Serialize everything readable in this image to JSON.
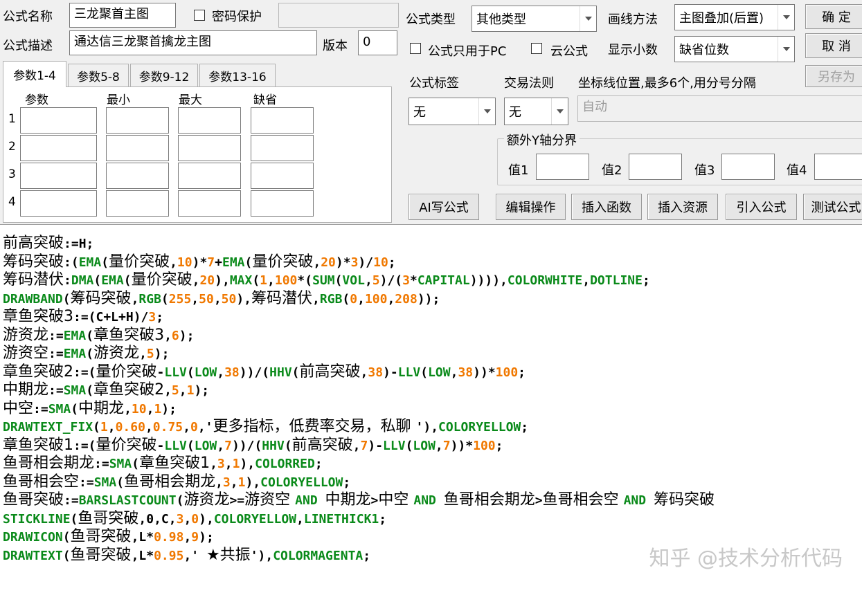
{
  "header": {
    "name_label": "公式名称",
    "name_value": "三龙聚首主图",
    "password_label": "密码保护",
    "password_value": "",
    "desc_label": "公式描述",
    "desc_value": "通达信三龙聚首擒龙主图",
    "version_label": "版本",
    "version_value": "0",
    "type_label": "公式类型",
    "type_value": "其他类型",
    "draw_label": "画线方法",
    "draw_value": "主图叠加(后置)",
    "pc_only_label": "公式只用于PC",
    "cloud_label": "云公式",
    "decimals_label": "显示小数",
    "decimals_value": "缺省位数"
  },
  "buttons": {
    "ok": "确 定",
    "cancel": "取 消",
    "save_as": "另存为",
    "ai": "AI写公式",
    "edit": "编辑操作",
    "insert_func": "插入函数",
    "insert_res": "插入资源",
    "import": "引入公式",
    "test": "测试公式"
  },
  "tabs": [
    "参数1-4",
    "参数5-8",
    "参数9-12",
    "参数13-16"
  ],
  "params": {
    "columns": [
      "参数",
      "最小",
      "最大",
      "缺省"
    ],
    "rows": [
      "1",
      "2",
      "3",
      "4"
    ]
  },
  "right": {
    "tag_label": "公式标签",
    "tag_value": "无",
    "rule_label": "交易法则",
    "rule_value": "无",
    "axis_label": "坐标线位置,最多6个,用分号分隔",
    "axis_value": "自动",
    "yaxis_group": "额外Y轴分界",
    "v1": "值1",
    "v2": "值2",
    "v3": "值3",
    "v4": "值4"
  },
  "code_lines": [
    [
      [
        "zh",
        "前高突破"
      ],
      [
        "pl",
        ":=H;"
      ]
    ],
    [
      [
        "zh",
        "筹码突破"
      ],
      [
        "pl",
        ":("
      ],
      [
        "fn",
        "EMA"
      ],
      [
        "pl",
        "("
      ],
      [
        "zh",
        "量价突破"
      ],
      [
        "pl",
        ","
      ],
      [
        "num",
        "10"
      ],
      [
        "pl",
        ")*"
      ],
      [
        "num",
        "7"
      ],
      [
        "pl",
        "+"
      ],
      [
        "fn",
        "EMA"
      ],
      [
        "pl",
        "("
      ],
      [
        "zh",
        "量价突破"
      ],
      [
        "pl",
        ","
      ],
      [
        "num",
        "20"
      ],
      [
        "pl",
        ")*"
      ],
      [
        "num",
        "3"
      ],
      [
        "pl",
        ")/"
      ],
      [
        "num",
        "10"
      ],
      [
        "pl",
        ";"
      ]
    ],
    [
      [
        "zh",
        "筹码潜伏"
      ],
      [
        "pl",
        ":"
      ],
      [
        "fn",
        "DMA"
      ],
      [
        "pl",
        "("
      ],
      [
        "fn",
        "EMA"
      ],
      [
        "pl",
        "("
      ],
      [
        "zh",
        "量价突破"
      ],
      [
        "pl",
        ","
      ],
      [
        "num",
        "20"
      ],
      [
        "pl",
        "),"
      ],
      [
        "fn",
        "MAX"
      ],
      [
        "pl",
        "("
      ],
      [
        "num",
        "1"
      ],
      [
        "pl",
        ","
      ],
      [
        "num",
        "100"
      ],
      [
        "pl",
        "*("
      ],
      [
        "fn",
        "SUM"
      ],
      [
        "pl",
        "("
      ],
      [
        "fn",
        "VOL"
      ],
      [
        "pl",
        ","
      ],
      [
        "num",
        "5"
      ],
      [
        "pl",
        ")/("
      ],
      [
        "num",
        "3"
      ],
      [
        "pl",
        "*"
      ],
      [
        "fn",
        "CAPITAL"
      ],
      [
        "pl",
        ")))),"
      ],
      [
        "kw",
        "COLORWHITE"
      ],
      [
        "pl",
        ","
      ],
      [
        "kw",
        "DOTLINE"
      ],
      [
        "pl",
        ";"
      ]
    ],
    [
      [
        "kw",
        "DRAWBAND"
      ],
      [
        "pl",
        "("
      ],
      [
        "zh",
        "筹码突破"
      ],
      [
        "pl",
        ","
      ],
      [
        "fn",
        "RGB"
      ],
      [
        "pl",
        "("
      ],
      [
        "num",
        "255"
      ],
      [
        "pl",
        ","
      ],
      [
        "num",
        "50"
      ],
      [
        "pl",
        ","
      ],
      [
        "num",
        "50"
      ],
      [
        "pl",
        "),"
      ],
      [
        "zh",
        "筹码潜伏"
      ],
      [
        "pl",
        ","
      ],
      [
        "fn",
        "RGB"
      ],
      [
        "pl",
        "("
      ],
      [
        "num",
        "0"
      ],
      [
        "pl",
        ","
      ],
      [
        "num",
        "100"
      ],
      [
        "pl",
        ","
      ],
      [
        "num",
        "208"
      ],
      [
        "pl",
        "));"
      ]
    ],
    [
      [
        "zh",
        "章鱼突破3"
      ],
      [
        "pl",
        ":=(C+L+H)/"
      ],
      [
        "num",
        "3"
      ],
      [
        "pl",
        ";"
      ]
    ],
    [
      [
        "zh",
        "游资龙"
      ],
      [
        "pl",
        ":="
      ],
      [
        "fn",
        "EMA"
      ],
      [
        "pl",
        "("
      ],
      [
        "zh",
        "章鱼突破3"
      ],
      [
        "pl",
        ","
      ],
      [
        "num",
        "6"
      ],
      [
        "pl",
        ");"
      ]
    ],
    [
      [
        "zh",
        "游资空"
      ],
      [
        "pl",
        ":="
      ],
      [
        "fn",
        "EMA"
      ],
      [
        "pl",
        "("
      ],
      [
        "zh",
        "游资龙"
      ],
      [
        "pl",
        ","
      ],
      [
        "num",
        "5"
      ],
      [
        "pl",
        ");"
      ]
    ],
    [
      [
        "zh",
        "章鱼突破2"
      ],
      [
        "pl",
        ":=("
      ],
      [
        "zh",
        "量价突破"
      ],
      [
        "pl",
        "-"
      ],
      [
        "fn",
        "LLV"
      ],
      [
        "pl",
        "("
      ],
      [
        "fn",
        "LOW"
      ],
      [
        "pl",
        ","
      ],
      [
        "num",
        "38"
      ],
      [
        "pl",
        "))/("
      ],
      [
        "fn",
        "HHV"
      ],
      [
        "pl",
        "("
      ],
      [
        "zh",
        "前高突破"
      ],
      [
        "pl",
        ","
      ],
      [
        "num",
        "38"
      ],
      [
        "pl",
        ")-"
      ],
      [
        "fn",
        "LLV"
      ],
      [
        "pl",
        "("
      ],
      [
        "fn",
        "LOW"
      ],
      [
        "pl",
        ","
      ],
      [
        "num",
        "38"
      ],
      [
        "pl",
        "))*"
      ],
      [
        "num",
        "100"
      ],
      [
        "pl",
        ";"
      ]
    ],
    [
      [
        "zh",
        "中期龙"
      ],
      [
        "pl",
        ":="
      ],
      [
        "fn",
        "SMA"
      ],
      [
        "pl",
        "("
      ],
      [
        "zh",
        "章鱼突破2"
      ],
      [
        "pl",
        ","
      ],
      [
        "num",
        "5"
      ],
      [
        "pl",
        ","
      ],
      [
        "num",
        "1"
      ],
      [
        "pl",
        ");"
      ]
    ],
    [
      [
        "zh",
        "中空"
      ],
      [
        "pl",
        ":="
      ],
      [
        "fn",
        "SMA"
      ],
      [
        "pl",
        "("
      ],
      [
        "zh",
        "中期龙"
      ],
      [
        "pl",
        ","
      ],
      [
        "num",
        "10"
      ],
      [
        "pl",
        ","
      ],
      [
        "num",
        "1"
      ],
      [
        "pl",
        ");"
      ]
    ],
    [
      [
        "kw",
        "DRAWTEXT_FIX"
      ],
      [
        "pl",
        "("
      ],
      [
        "num",
        "1"
      ],
      [
        "pl",
        ","
      ],
      [
        "num",
        "0.60"
      ],
      [
        "pl",
        ","
      ],
      [
        "num",
        "0.75"
      ],
      [
        "pl",
        ","
      ],
      [
        "num",
        "0"
      ],
      [
        "pl",
        ",'"
      ],
      [
        "zh",
        "更多指标，低费率交易，私聊 "
      ],
      [
        "pl",
        "'),"
      ],
      [
        "kw",
        "COLORYELLOW"
      ],
      [
        "pl",
        ";"
      ]
    ],
    [
      [
        "zh",
        "章鱼突破1"
      ],
      [
        "pl",
        ":=("
      ],
      [
        "zh",
        "量价突破"
      ],
      [
        "pl",
        "-"
      ],
      [
        "fn",
        "LLV"
      ],
      [
        "pl",
        "("
      ],
      [
        "fn",
        "LOW"
      ],
      [
        "pl",
        ","
      ],
      [
        "num",
        "7"
      ],
      [
        "pl",
        "))/("
      ],
      [
        "fn",
        "HHV"
      ],
      [
        "pl",
        "("
      ],
      [
        "zh",
        "前高突破"
      ],
      [
        "pl",
        ","
      ],
      [
        "num",
        "7"
      ],
      [
        "pl",
        ")-"
      ],
      [
        "fn",
        "LLV"
      ],
      [
        "pl",
        "("
      ],
      [
        "fn",
        "LOW"
      ],
      [
        "pl",
        ","
      ],
      [
        "num",
        "7"
      ],
      [
        "pl",
        "))*"
      ],
      [
        "num",
        "100"
      ],
      [
        "pl",
        ";"
      ]
    ],
    [
      [
        "zh",
        "鱼哥相会期龙"
      ],
      [
        "pl",
        ":="
      ],
      [
        "fn",
        "SMA"
      ],
      [
        "pl",
        "("
      ],
      [
        "zh",
        "章鱼突破1"
      ],
      [
        "pl",
        ","
      ],
      [
        "num",
        "3"
      ],
      [
        "pl",
        ","
      ],
      [
        "num",
        "1"
      ],
      [
        "pl",
        "),"
      ],
      [
        "kw",
        "COLORRED"
      ],
      [
        "pl",
        ";"
      ]
    ],
    [
      [
        "zh",
        "鱼哥相会空"
      ],
      [
        "pl",
        ":="
      ],
      [
        "fn",
        "SMA"
      ],
      [
        "pl",
        "("
      ],
      [
        "zh",
        "鱼哥相会期龙"
      ],
      [
        "pl",
        ","
      ],
      [
        "num",
        "3"
      ],
      [
        "pl",
        ","
      ],
      [
        "num",
        "1"
      ],
      [
        "pl",
        "),"
      ],
      [
        "kw",
        "COLORYELLOW"
      ],
      [
        "pl",
        ";"
      ]
    ],
    [
      [
        "zh",
        "鱼哥突破"
      ],
      [
        "pl",
        ":="
      ],
      [
        "fn",
        "BARSLASTCOUNT"
      ],
      [
        "pl",
        "("
      ],
      [
        "zh",
        "游资龙"
      ],
      [
        "pl",
        ">="
      ],
      [
        "zh",
        "游资空 "
      ],
      [
        "kw",
        "AND"
      ],
      [
        "pl",
        " "
      ],
      [
        "zh",
        "中期龙"
      ],
      [
        "pl",
        ">"
      ],
      [
        "zh",
        "中空 "
      ],
      [
        "kw",
        "AND"
      ],
      [
        "pl",
        " "
      ],
      [
        "zh",
        "鱼哥相会期龙"
      ],
      [
        "pl",
        ">"
      ],
      [
        "zh",
        "鱼哥相会空 "
      ],
      [
        "kw",
        "AND"
      ],
      [
        "pl",
        " "
      ],
      [
        "zh",
        "筹码突破"
      ]
    ],
    [
      [
        "kw",
        "STICKLINE"
      ],
      [
        "pl",
        "("
      ],
      [
        "zh",
        "鱼哥突破"
      ],
      [
        "pl",
        ",0,C,"
      ],
      [
        "num",
        "3"
      ],
      [
        "pl",
        ","
      ],
      [
        "num",
        "0"
      ],
      [
        "pl",
        "),"
      ],
      [
        "kw",
        "COLORYELLOW"
      ],
      [
        "pl",
        ","
      ],
      [
        "kw",
        "LINETHICK1"
      ],
      [
        "pl",
        ";"
      ]
    ],
    [
      [
        "kw",
        "DRAWICON"
      ],
      [
        "pl",
        "("
      ],
      [
        "zh",
        "鱼哥突破"
      ],
      [
        "pl",
        ",L*"
      ],
      [
        "num",
        "0.98"
      ],
      [
        "pl",
        ","
      ],
      [
        "num",
        "9"
      ],
      [
        "pl",
        ");"
      ]
    ],
    [
      [
        "kw",
        "DRAWTEXT"
      ],
      [
        "pl",
        "("
      ],
      [
        "zh",
        "鱼哥突破"
      ],
      [
        "pl",
        ",L*"
      ],
      [
        "num",
        "0.95"
      ],
      [
        "pl",
        ",' "
      ],
      [
        "zh",
        "★共振"
      ],
      [
        "pl",
        "'),"
      ],
      [
        "kw",
        "COLORMAGENTA"
      ],
      [
        "pl",
        ";"
      ]
    ]
  ],
  "watermark": "知乎 @技术分析代码"
}
